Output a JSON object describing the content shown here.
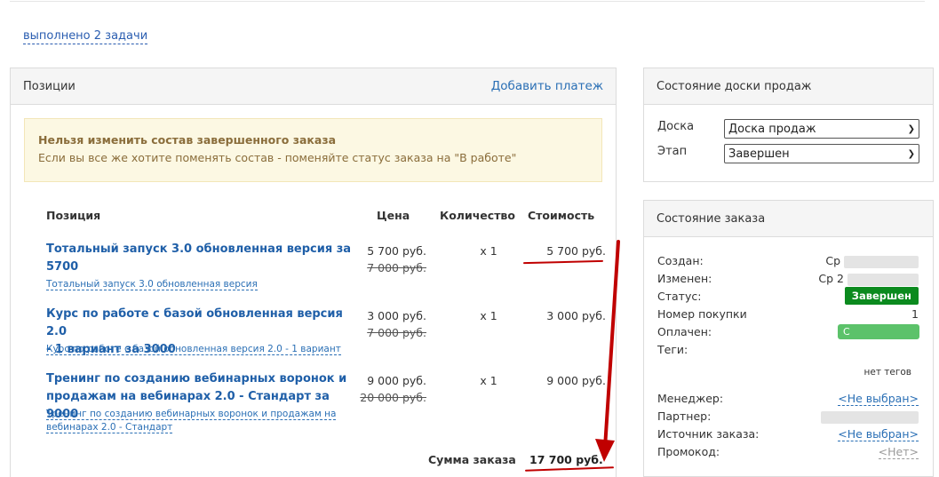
{
  "top": {
    "done_link": "выполнено 2 задачи"
  },
  "positions": {
    "title": "Позиции",
    "add_payment": "Добавить платеж",
    "alert_title": "Нельзя изменить состав завершенного заказа",
    "alert_text": "Если вы все же хотите поменять состав - поменяйте статус заказа на \"В работе\"",
    "headers": {
      "position": "Позиция",
      "price": "Цена",
      "qty": "Количество",
      "cost": "Стоимость"
    },
    "rows": [
      {
        "title_line1": "Тотальный запуск 3.0 обновленная версия за",
        "title_line2": "5700",
        "sub_line1": "Тотальный запуск 3.0 обновленная версия",
        "sub_line2": "",
        "price": "5 700 руб.",
        "old_price": "7 000 руб.",
        "qty": "x 1",
        "cost": "5 700 руб."
      },
      {
        "title_line1": "Курс по работе с базой обновленная версия 2.0",
        "title_line2": "- 1 вариант за 3000",
        "sub_line1": "Курс по работе с базой обновленная версия 2.0 - 1 вариант",
        "sub_line2": "",
        "price": "3 000 руб.",
        "old_price": "7 000 руб.",
        "qty": "x 1",
        "cost": "3 000 руб."
      },
      {
        "title_line1": "Тренинг по созданию вебинарных воронок и",
        "title_line2": "продажам на вебинарах 2.0 - Стандарт за 9000",
        "sub_line1": "Тренинг по созданию вебинарных воронок и продажам на",
        "sub_line2": "вебинарах 2.0 - Стандарт",
        "price": "9 000 руб.",
        "old_price": "20 000 руб.",
        "qty": "x 1",
        "cost": "9 000 руб."
      }
    ],
    "sum_label": "Сумма заказа",
    "sum_value": "17 700 руб."
  },
  "board": {
    "title": "Состояние доски продаж",
    "board_label": "Доска",
    "board_value": "Доска продаж",
    "stage_label": "Этап",
    "stage_value": "Завершен"
  },
  "order": {
    "title": "Состояние заказа",
    "created_label": "Создан:",
    "created_value": "Ср",
    "changed_label": "Изменен:",
    "changed_value": "Ср 2",
    "status_label": "Статус:",
    "status_value": "Завершен",
    "purchase_label": "Номер покупки",
    "purchase_value": "1",
    "paid_label": "Оплачен:",
    "paid_value": "С",
    "tags_label": "Теги:",
    "tags_value": "нет тегов",
    "manager_label": "Менеджер:",
    "manager_value": "<Не выбран>",
    "partner_label": "Партнер:",
    "source_label": "Источник заказа:",
    "source_value": "<Не выбран>",
    "promo_label": "Промокод:",
    "promo_value": "<Нет>"
  },
  "colors": {
    "annotation_red": "#c00000",
    "link_blue": "#2a6fb5",
    "status_green": "#0b8a1e",
    "alert_bg": "#fcf8e3"
  }
}
